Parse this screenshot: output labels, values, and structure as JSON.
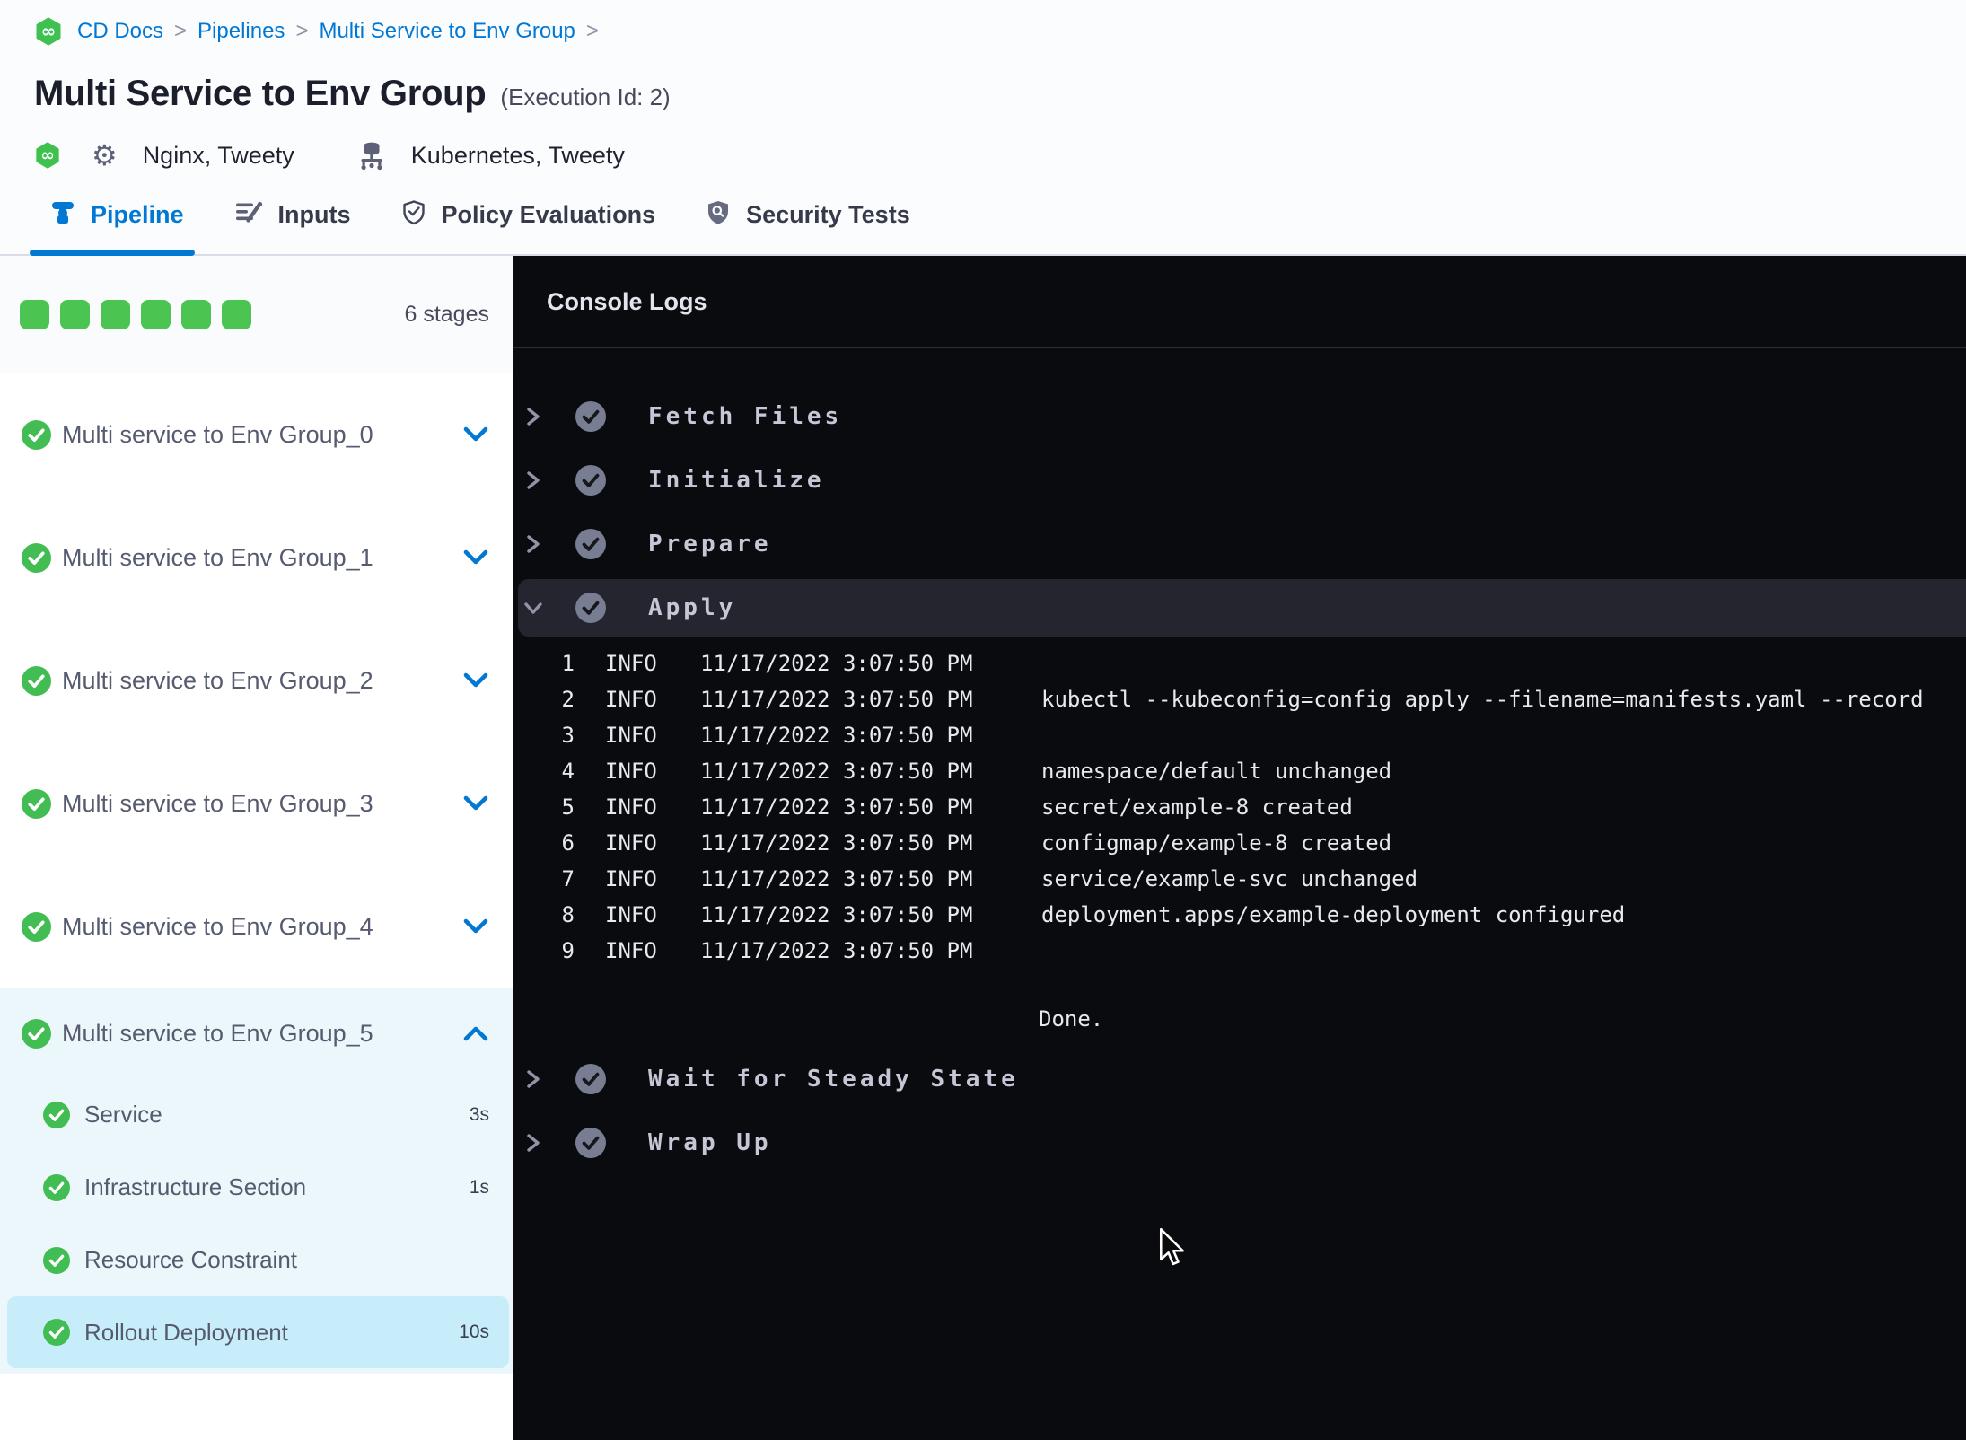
{
  "breadcrumb": {
    "separator": ">",
    "items": [
      "CD Docs",
      "Pipelines",
      "Multi Service to Env Group"
    ]
  },
  "header": {
    "title": "Multi Service to Env Group",
    "execution_label": "(Execution Id: 2)",
    "services_label": "Nginx, Tweety",
    "environments_label": "Kubernetes, Tweety"
  },
  "tabs": [
    {
      "id": "pipeline",
      "label": "Pipeline",
      "icon": "pipeline-icon",
      "active": true
    },
    {
      "id": "inputs",
      "label": "Inputs",
      "icon": "inputs-icon",
      "active": false
    },
    {
      "id": "policy-evaluations",
      "label": "Policy Evaluations",
      "icon": "policy-icon",
      "active": false
    },
    {
      "id": "security-tests",
      "label": "Security Tests",
      "icon": "security-icon",
      "active": false
    }
  ],
  "sidebar": {
    "stages_count_label": "6 stages",
    "progress_squares": 6,
    "stages": [
      {
        "label": "Multi service to Env Group_0",
        "status": "success",
        "expanded": false
      },
      {
        "label": "Multi service to Env Group_1",
        "status": "success",
        "expanded": false
      },
      {
        "label": "Multi service to Env Group_2",
        "status": "success",
        "expanded": false
      },
      {
        "label": "Multi service to Env Group_3",
        "status": "success",
        "expanded": false
      },
      {
        "label": "Multi service to Env Group_4",
        "status": "success",
        "expanded": false
      },
      {
        "label": "Multi service to Env Group_5",
        "status": "success",
        "expanded": true,
        "steps": [
          {
            "label": "Service",
            "duration": "3s",
            "selected": false
          },
          {
            "label": "Infrastructure Section",
            "duration": "1s",
            "selected": false
          },
          {
            "label": "Resource Constraint",
            "duration": "",
            "selected": false
          },
          {
            "label": "Rollout Deployment",
            "duration": "10s",
            "selected": true
          }
        ]
      }
    ]
  },
  "console": {
    "title": "Console Logs",
    "sections": [
      {
        "label": "Fetch Files",
        "status": "success",
        "expanded": false
      },
      {
        "label": "Initialize",
        "status": "success",
        "expanded": false
      },
      {
        "label": "Prepare",
        "status": "success",
        "expanded": false
      },
      {
        "label": "Apply",
        "status": "success",
        "expanded": true,
        "logs": [
          {
            "line": "1",
            "level": "INFO",
            "timestamp": "11/17/2022 3:07:50 PM",
            "message": ""
          },
          {
            "line": "2",
            "level": "INFO",
            "timestamp": "11/17/2022 3:07:50 PM",
            "message": "kubectl --kubeconfig=config apply --filename=manifests.yaml --record"
          },
          {
            "line": "3",
            "level": "INFO",
            "timestamp": "11/17/2022 3:07:50 PM",
            "message": ""
          },
          {
            "line": "4",
            "level": "INFO",
            "timestamp": "11/17/2022 3:07:50 PM",
            "message": "namespace/default unchanged"
          },
          {
            "line": "5",
            "level": "INFO",
            "timestamp": "11/17/2022 3:07:50 PM",
            "message": "secret/example-8 created"
          },
          {
            "line": "6",
            "level": "INFO",
            "timestamp": "11/17/2022 3:07:50 PM",
            "message": "configmap/example-8 created"
          },
          {
            "line": "7",
            "level": "INFO",
            "timestamp": "11/17/2022 3:07:50 PM",
            "message": "service/example-svc unchanged"
          },
          {
            "line": "8",
            "level": "INFO",
            "timestamp": "11/17/2022 3:07:50 PM",
            "message": "deployment.apps/example-deployment configured"
          },
          {
            "line": "9",
            "level": "INFO",
            "timestamp": "11/17/2022 3:07:50 PM",
            "message": ""
          }
        ],
        "after_logs_text": "Done."
      },
      {
        "label": "Wait for Steady State",
        "status": "success",
        "expanded": false
      },
      {
        "label": "Wrap Up",
        "status": "success",
        "expanded": false
      }
    ]
  },
  "colors": {
    "accent_blue": "#0278d5",
    "success_green": "#42ba57",
    "console_bg": "#0a0b0e",
    "expanded_stage_bg": "#ecf7fc",
    "selected_step_bg": "#c7ecfa",
    "selected_section_bg": "#24252e"
  }
}
